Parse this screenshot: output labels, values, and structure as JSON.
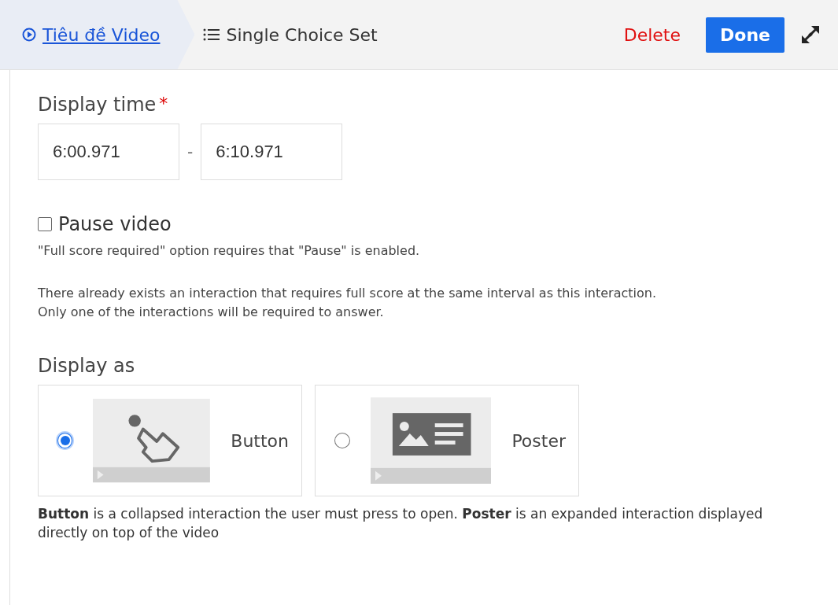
{
  "header": {
    "breadcrumb": {
      "label": "Tiêu đề Video"
    },
    "current": {
      "label": "Single Choice Set"
    },
    "delete_button": "Delete",
    "done_button": "Done"
  },
  "display_time": {
    "label": "Display time",
    "required_mark": "*",
    "start": "6:00.971",
    "separator": "-",
    "end": "6:10.971"
  },
  "pause_video": {
    "label": "Pause video",
    "checked": false
  },
  "notes": [
    "\"Full score required\" option requires that \"Pause\" is enabled.",
    "There already exists an interaction that requires full score at the same interval as this interaction.",
    "Only one of the interactions will be required to answer."
  ],
  "display_as": {
    "label": "Display as",
    "options": [
      {
        "kind": "button",
        "label": "Button",
        "selected": true
      },
      {
        "kind": "poster",
        "label": "Poster",
        "selected": false
      }
    ],
    "description": "**Button** is a collapsed interaction the user must press to open. **Poster** is an expanded interaction displayed directly on top of the video"
  }
}
